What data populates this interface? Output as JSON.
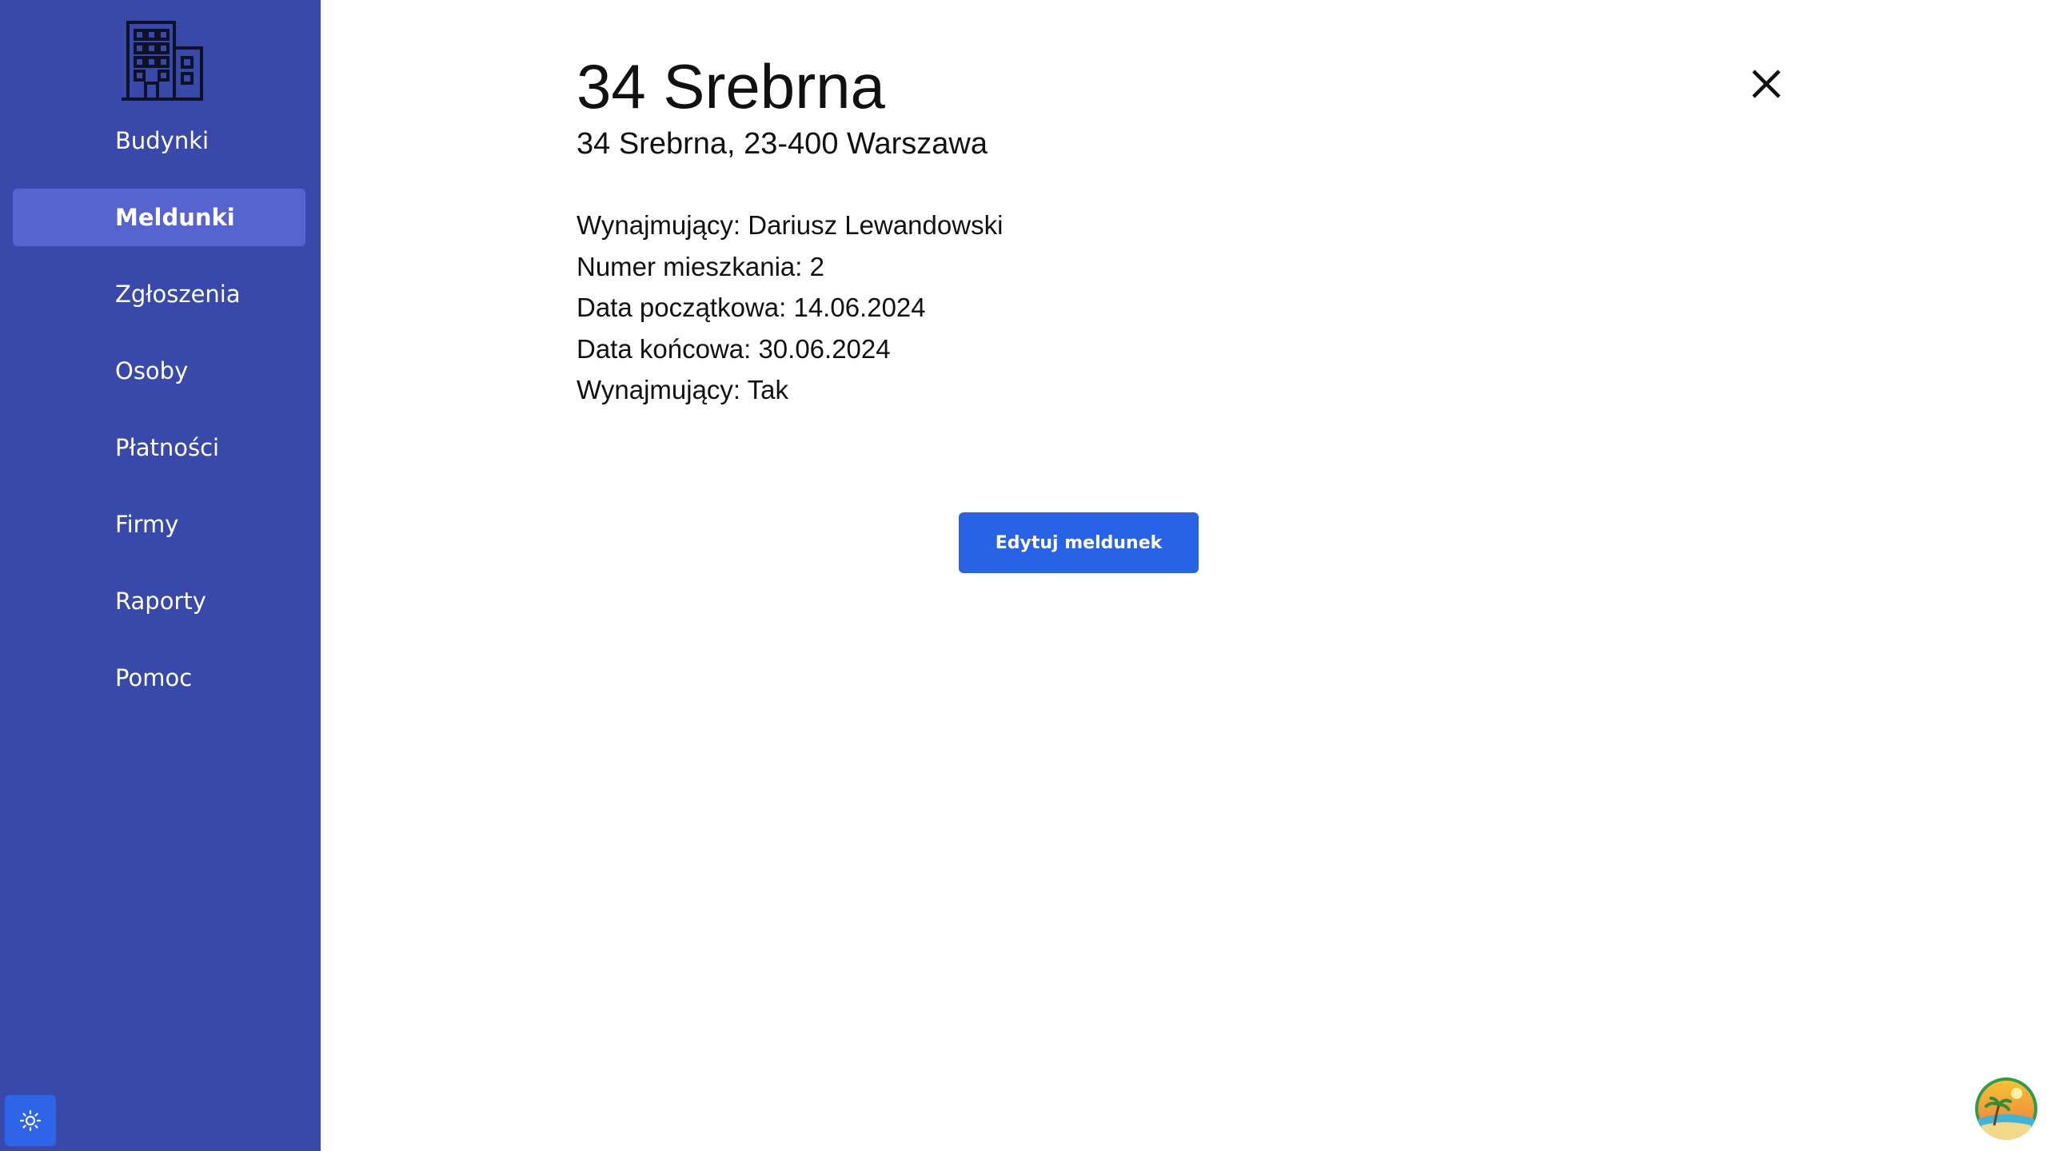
{
  "sidebar": {
    "logo_icon": "building-icon",
    "items": [
      {
        "label": "Budynki",
        "active": false
      },
      {
        "label": "Meldunki",
        "active": true
      },
      {
        "label": "Zgłoszenia",
        "active": false
      },
      {
        "label": "Osoby",
        "active": false
      },
      {
        "label": "Płatności",
        "active": false
      },
      {
        "label": "Firmy",
        "active": false
      },
      {
        "label": "Raporty",
        "active": false
      },
      {
        "label": "Pomoc",
        "active": false
      }
    ],
    "theme_toggle_icon": "sun-icon"
  },
  "detail": {
    "title": "34 Srebrna",
    "address": "34 Srebrna, 23-400 Warszawa",
    "rows": [
      "Wynajmujący: Dariusz Lewandowski",
      "Numer mieszkania: 2",
      "Data początkowa: 14.06.2024",
      "Data końcowa: 30.06.2024",
      "Wynajmujący: Tak"
    ],
    "edit_button_label": "Edytuj meldunek",
    "close_icon": "close-icon"
  },
  "colors": {
    "sidebar_bg": "#3949aa",
    "sidebar_active": "#5564cf",
    "primary_button": "#2763e4",
    "theme_toggle_bg": "#2f64e8"
  }
}
